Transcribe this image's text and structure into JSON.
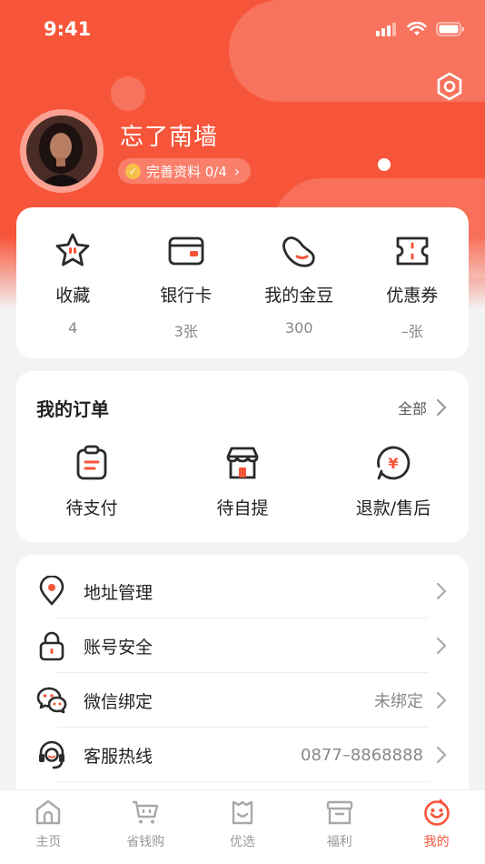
{
  "status_bar": {
    "time": "9:41"
  },
  "profile": {
    "name": "忘了南墙",
    "complete_label": "完善资料 0/4"
  },
  "stats": [
    {
      "label": "收藏",
      "value": "4",
      "icon": "star-icon"
    },
    {
      "label": "银行卡",
      "value": "3张",
      "icon": "bank-card-icon"
    },
    {
      "label": "我的金豆",
      "value": "300",
      "icon": "bean-icon"
    },
    {
      "label": "优惠券",
      "value": "–张",
      "icon": "coupon-icon"
    }
  ],
  "orders": {
    "title": "我的订单",
    "all_label": "全部",
    "items": [
      {
        "label": "待支付",
        "icon": "clipboard-icon"
      },
      {
        "label": "待自提",
        "icon": "shop-icon"
      },
      {
        "label": "退款/售后",
        "icon": "refund-icon"
      }
    ]
  },
  "menu": [
    {
      "label": "地址管理",
      "value": "",
      "icon": "location-icon"
    },
    {
      "label": "账号安全",
      "value": "",
      "icon": "lock-icon"
    },
    {
      "label": "微信绑定",
      "value": "未绑定",
      "icon": "wechat-icon"
    },
    {
      "label": "客服热线",
      "value": "0877–8868888",
      "icon": "headset-icon"
    }
  ],
  "tabbar": [
    {
      "label": "主页",
      "icon": "home-icon",
      "active": false
    },
    {
      "label": "省钱购",
      "icon": "cart-icon",
      "active": false
    },
    {
      "label": "优选",
      "icon": "bag-icon",
      "active": false
    },
    {
      "label": "福利",
      "icon": "gift-box-icon",
      "active": false
    },
    {
      "label": "我的",
      "icon": "profile-face-icon",
      "active": true
    }
  ],
  "colors": {
    "accent": "#f7553a",
    "dark": "#2b2b2b",
    "muted": "#888888"
  }
}
